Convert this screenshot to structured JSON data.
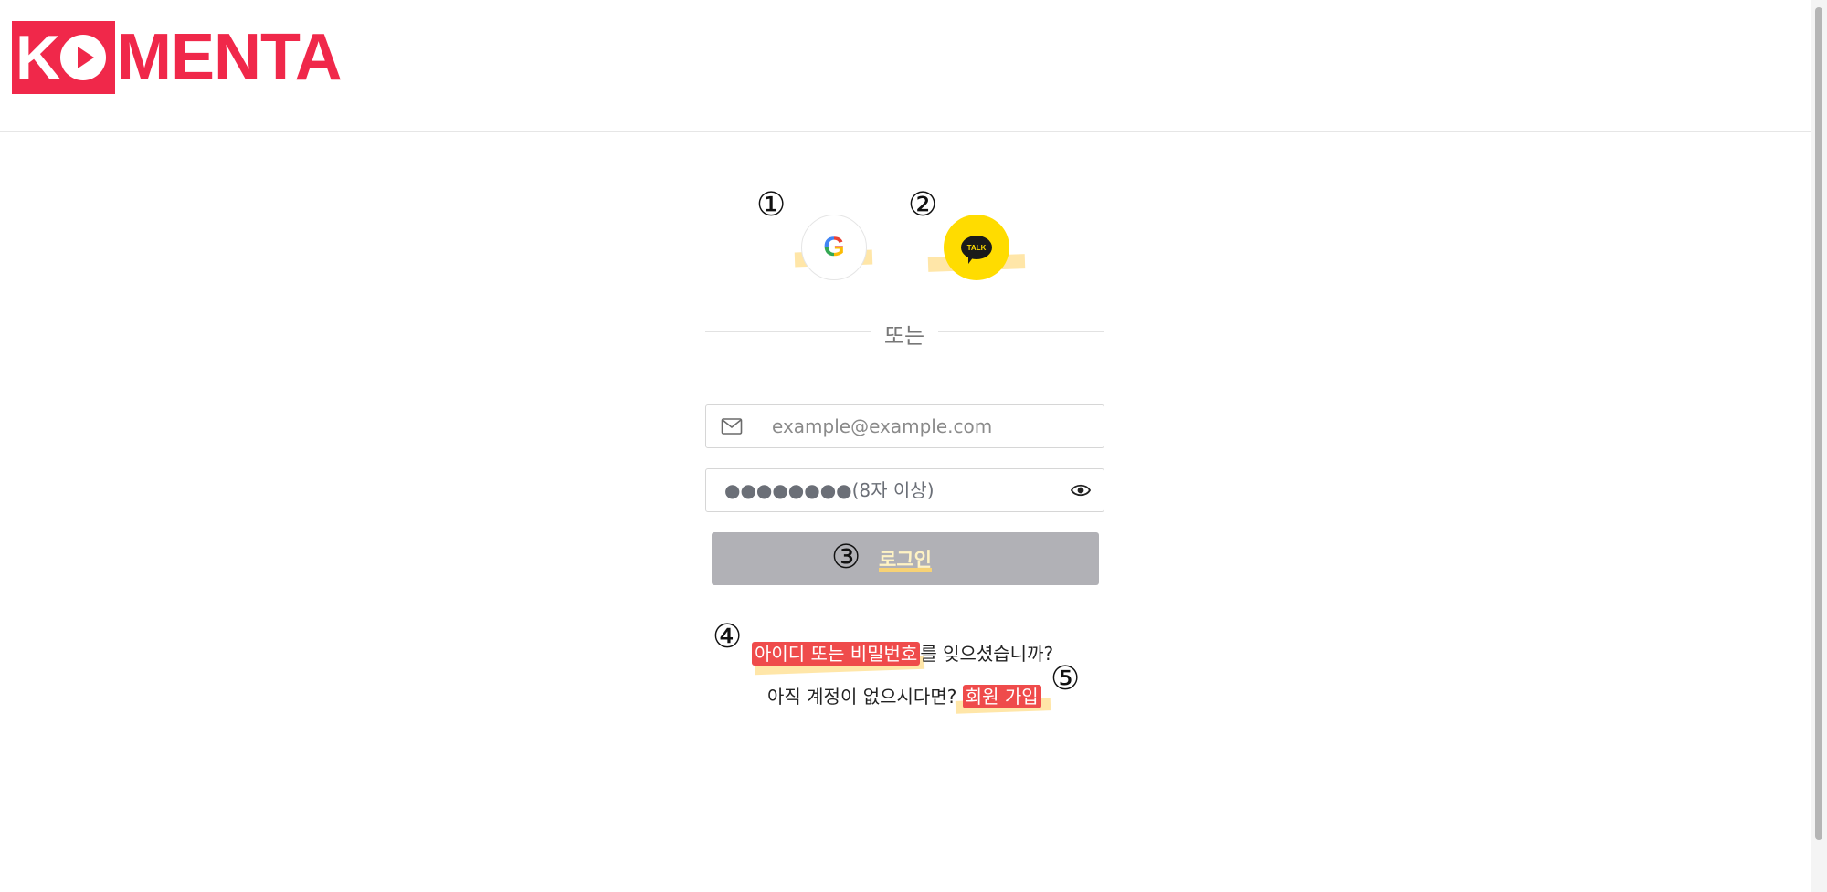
{
  "header": {
    "logo_text_box": "KO",
    "logo_text_rest": "MENTA",
    "brand_color": "#f0284a"
  },
  "annotations": [
    "①",
    "②",
    "③",
    "④",
    "⑤"
  ],
  "social": {
    "google_icon": "google-g-icon",
    "kakao_icon": "kakao-talk-icon",
    "kakao_label": "TALK",
    "kakao_color": "#ffdc00"
  },
  "divider": {
    "text": "또는"
  },
  "form": {
    "email_placeholder": "example@example.com",
    "email_icon": "mail-icon",
    "password_placeholder": "●●●●●●●●(8자 이상)",
    "password_toggle_icon": "eye-icon",
    "login_label": "로그인",
    "login_button_color": "#b1b1b6"
  },
  "links": {
    "forgot_link": "아이디 또는 비밀번호",
    "forgot_suffix": "를 잊으셨습니까?",
    "signup_prefix": "아직 계정이 없으시다면? ",
    "signup_link": "회원 가입",
    "link_color": "#ef4b4b"
  }
}
